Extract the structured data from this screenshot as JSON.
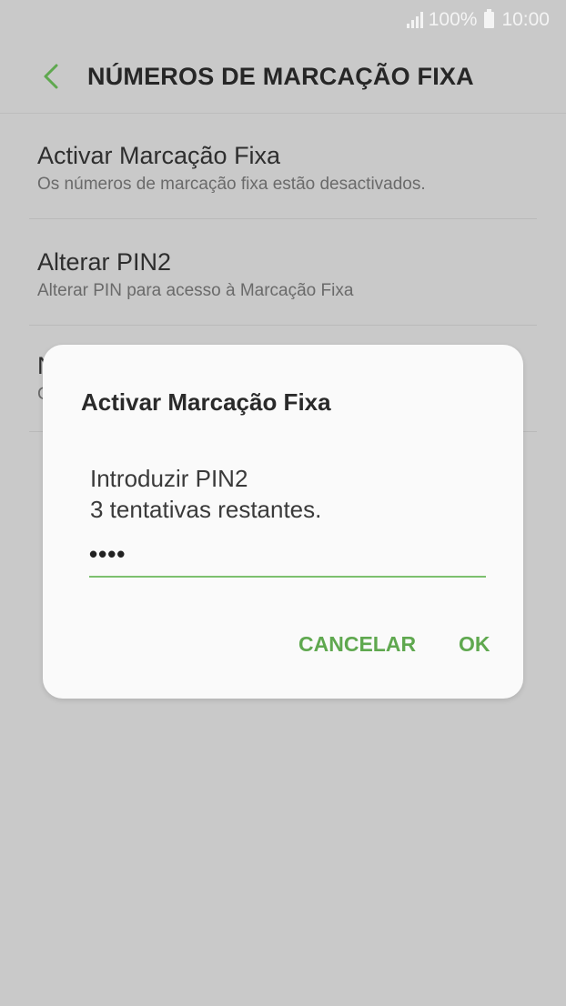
{
  "status_bar": {
    "battery": "100%",
    "time": "10:00",
    "icons": [
      "signal-icon",
      "battery-icon"
    ]
  },
  "header": {
    "back_icon": "chevron-left-icon",
    "title": "NÚMEROS DE MARCAÇÃO FIXA"
  },
  "settings": {
    "items": [
      {
        "title": "Activar Marcação Fixa",
        "subtitle": "Os números de marcação fixa estão desactivados."
      },
      {
        "title": "Alterar PIN2",
        "subtitle": "Alterar PIN para acesso à Marcação Fixa"
      },
      {
        "title": "N",
        "subtitle": "C"
      }
    ]
  },
  "dialog": {
    "title": "Activar Marcação Fixa",
    "pin_label": "Introduzir PIN2",
    "attempts": "3 tentativas restantes.",
    "pin_value": "••••",
    "cancel_label": "CANCELAR",
    "ok_label": "OK"
  },
  "colors": {
    "accent": "#5fa84f",
    "input_underline": "#7cc06e",
    "dimmed_background": "#c9c9c9",
    "dialog_background": "#fafafa"
  }
}
